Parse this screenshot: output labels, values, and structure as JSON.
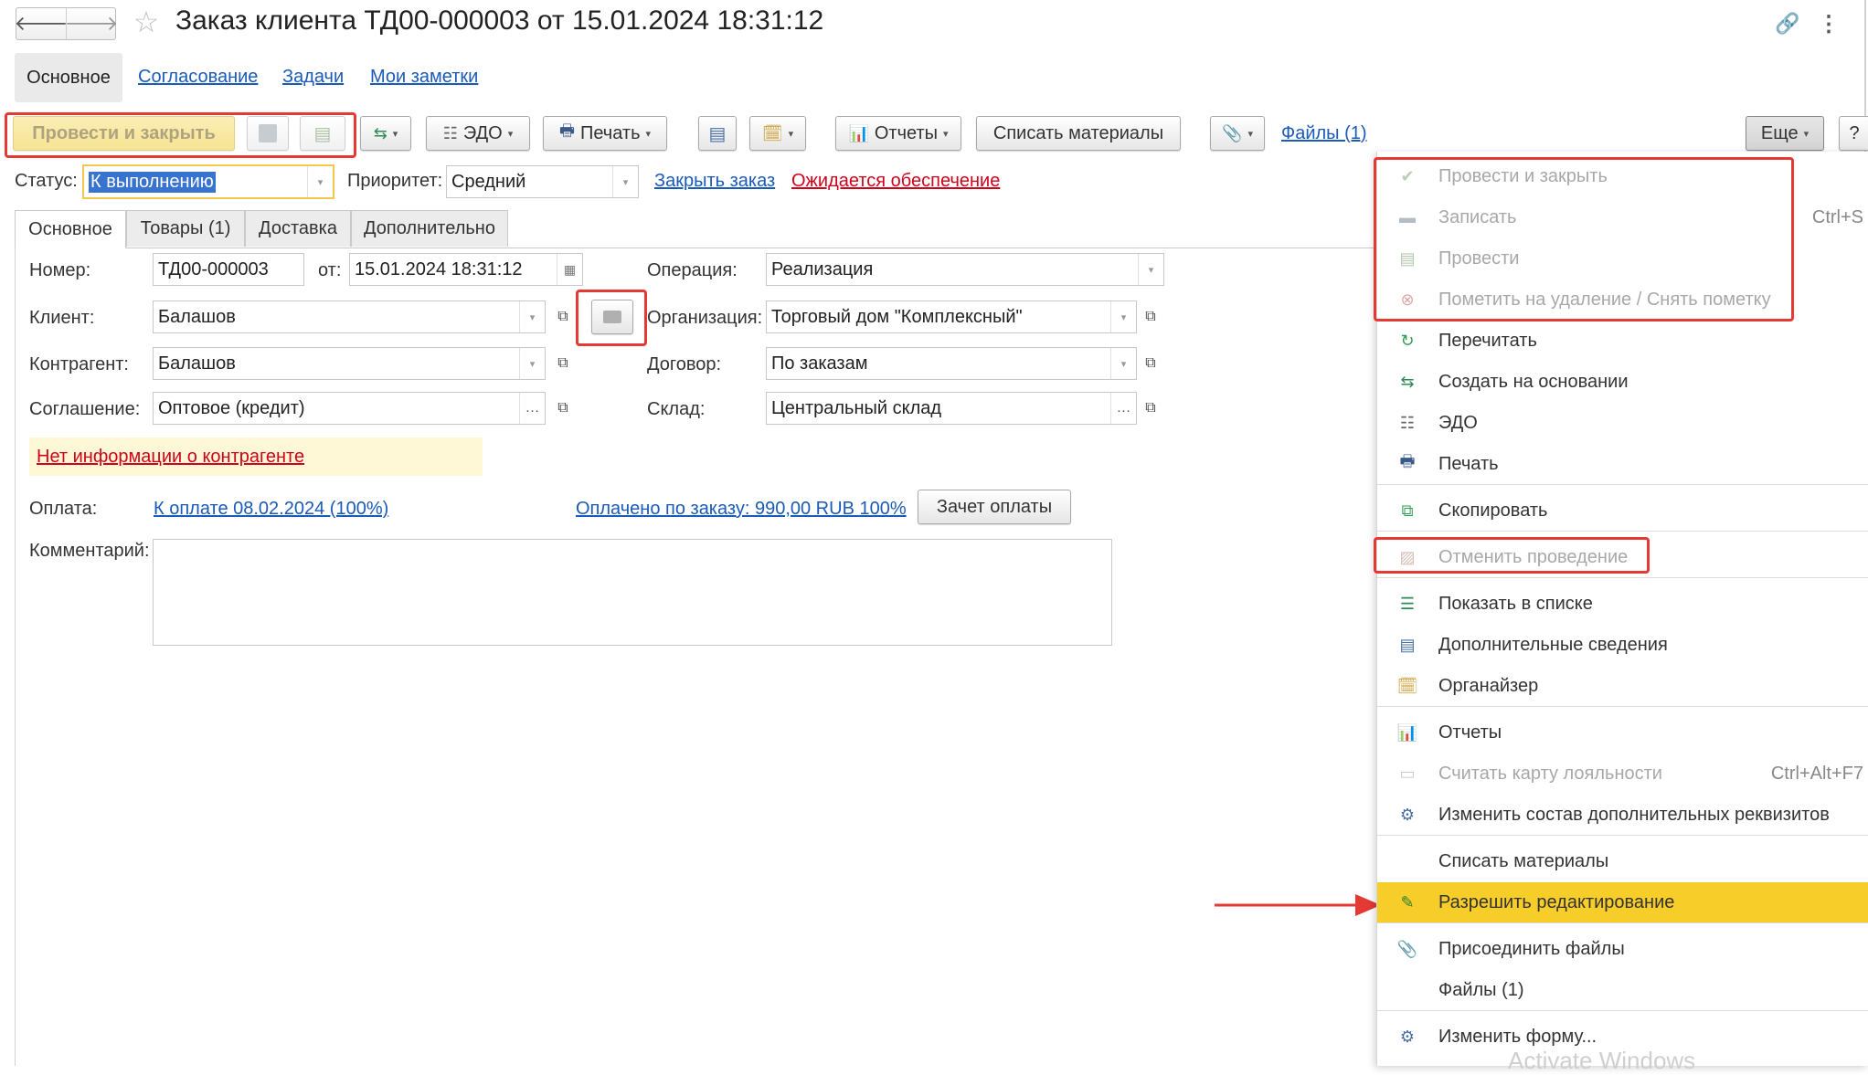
{
  "window": {
    "title": "Заказ клиента ТД00-000003 от 15.01.2024 18:31:12",
    "back_icon": "arrow-left-icon",
    "forward_icon": "arrow-right-icon",
    "star_icon": "star-icon",
    "link_icon": "link-icon",
    "more_icon": "kebab-icon"
  },
  "nav_tabs": [
    "Основное",
    "Согласование",
    "Задачи",
    "Мои заметки"
  ],
  "toolbar": {
    "post_close": "Провести и закрыть",
    "edo": "ЭДО",
    "print": "Печать",
    "reports": "Отчеты",
    "write_off": "Списать материалы",
    "files": "Файлы (1)",
    "more": "Еще",
    "help": "?"
  },
  "status_row": {
    "status_label": "Статус:",
    "status_value": "К выполнению",
    "priority_label": "Приоритет:",
    "priority_value": "Средний",
    "close_order": "Закрыть заказ",
    "awaiting": "Ожидается обеспечение"
  },
  "form_tabs": [
    "Основное",
    "Товары (1)",
    "Доставка",
    "Дополнительно"
  ],
  "form": {
    "number_label": "Номер:",
    "number_value": "ТД00-000003",
    "from_label": "от:",
    "date_value": "15.01.2024 18:31:12",
    "operation_label": "Операция:",
    "operation_value": "Реализация",
    "client_label": "Клиент:",
    "client_value": "Балашов",
    "org_label": "Организация:",
    "org_value": "Торговый дом \"Комплексный\"",
    "counterparty_label": "Контрагент:",
    "counterparty_value": "Балашов",
    "contract_label": "Договор:",
    "contract_value": "По заказам",
    "agreement_label": "Соглашение:",
    "agreement_value": "Оптовое (кредит)",
    "warehouse_label": "Склад:",
    "warehouse_value": "Центральный склад",
    "no_info": "Нет информации о контрагенте",
    "payment_label": "Оплата:",
    "payment_link": "К оплате 08.02.2024 (100%)",
    "paid_link": "Оплачено по заказу: 990,00 RUB 100%",
    "offset_button": "Зачет оплаты",
    "comment_label": "Комментарий:",
    "comment_value": ""
  },
  "menu": {
    "items": [
      {
        "label": "Провести и закрыть",
        "icon": "post-close-icon",
        "disabled": true,
        "shortcut": ""
      },
      {
        "label": "Записать",
        "icon": "save-icon",
        "disabled": true,
        "shortcut": "Ctrl+S"
      },
      {
        "label": "Провести",
        "icon": "post-icon",
        "disabled": true,
        "shortcut": ""
      },
      {
        "label": "Пометить на удаление / Снять пометку",
        "icon": "delete-mark-icon",
        "disabled": true,
        "shortcut": ""
      },
      {
        "label": "Перечитать",
        "icon": "refresh-icon",
        "disabled": false,
        "shortcut": ""
      },
      {
        "label": "Создать на основании",
        "icon": "create-based-icon",
        "disabled": false,
        "shortcut": ""
      },
      {
        "label": "ЭДО",
        "icon": "edo-icon",
        "disabled": false,
        "shortcut": ""
      },
      {
        "label": "Печать",
        "icon": "printer-icon",
        "disabled": false,
        "shortcut": ""
      },
      {
        "label": "Скопировать",
        "icon": "copy-icon",
        "disabled": false,
        "shortcut": ""
      },
      {
        "label": "Отменить проведение",
        "icon": "unpost-icon",
        "disabled": true,
        "shortcut": ""
      },
      {
        "label": "Показать в списке",
        "icon": "show-in-list-icon",
        "disabled": false,
        "shortcut": ""
      },
      {
        "label": "Дополнительные сведения",
        "icon": "additional-info-icon",
        "disabled": false,
        "shortcut": ""
      },
      {
        "label": "Органайзер",
        "icon": "organizer-icon",
        "disabled": false,
        "shortcut": ""
      },
      {
        "label": "Отчеты",
        "icon": "reports-icon",
        "disabled": false,
        "shortcut": ""
      },
      {
        "label": "Считать карту лояльности",
        "icon": "loyalty-card-icon",
        "disabled": true,
        "shortcut": "Ctrl+Alt+F7"
      },
      {
        "label": "Изменить состав дополнительных реквизитов",
        "icon": "attributes-icon",
        "disabled": false,
        "shortcut": ""
      },
      {
        "label": "Списать материалы",
        "icon": "",
        "disabled": false,
        "shortcut": ""
      },
      {
        "label": "Разрешить редактирование",
        "icon": "edit-allow-icon",
        "disabled": false,
        "shortcut": ""
      },
      {
        "label": "Присоединить файлы",
        "icon": "paperclip-icon",
        "disabled": false,
        "shortcut": ""
      },
      {
        "label": "Файлы (1)",
        "icon": "",
        "disabled": false,
        "shortcut": ""
      },
      {
        "label": "Изменить форму...",
        "icon": "form-settings-icon",
        "disabled": false,
        "shortcut": ""
      }
    ]
  },
  "watermark": "Activate Windows",
  "colors": {
    "highlight": "#f7cd2a",
    "annotation": "#e53935",
    "link": "#1a5ab8",
    "warning_link": "#d0021b",
    "warning_bg": "#fff8d6"
  }
}
